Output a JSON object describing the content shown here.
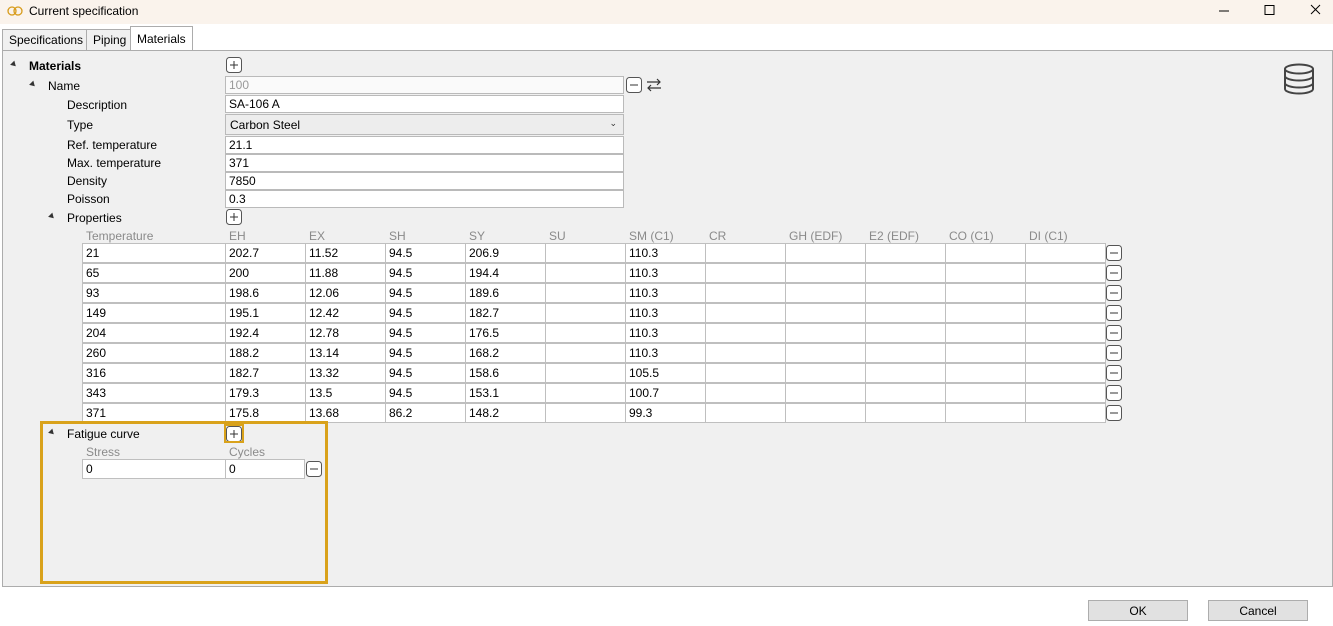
{
  "window": {
    "title": "Current specification",
    "title_icon": "link-icon",
    "controls": [
      "minimize-icon",
      "maximize-icon",
      "close-icon"
    ]
  },
  "tabs": [
    {
      "label": "Specifications",
      "active": false
    },
    {
      "label": "Piping",
      "active": false
    },
    {
      "label": "Materials",
      "active": true
    }
  ],
  "tree": {
    "materials_label": "Materials",
    "name_label": "Name",
    "name_value": "100",
    "fields": [
      {
        "label": "Description",
        "value": "SA-106 A"
      },
      {
        "label": "Type",
        "value": "Carbon Steel"
      },
      {
        "label": "Ref. temperature",
        "value": "21.1"
      },
      {
        "label": "Max. temperature",
        "value": "371"
      },
      {
        "label": "Density",
        "value": "7850"
      },
      {
        "label": "Poisson",
        "value": "0.3"
      }
    ],
    "properties_label": "Properties",
    "fatigue_label": "Fatigue curve"
  },
  "properties": {
    "columns": [
      "Temperature",
      "EH",
      "EX",
      "SH",
      "SY",
      "SU",
      "SM (C1)",
      "CR",
      "GH (EDF)",
      "E2 (EDF)",
      "CO (C1)",
      "DI (C1)"
    ],
    "rows": [
      [
        "21",
        "202.7",
        "11.52",
        "94.5",
        "206.9",
        "",
        "110.3",
        "",
        "",
        "",
        "",
        ""
      ],
      [
        "65",
        "200",
        "11.88",
        "94.5",
        "194.4",
        "",
        "110.3",
        "",
        "",
        "",
        "",
        ""
      ],
      [
        "93",
        "198.6",
        "12.06",
        "94.5",
        "189.6",
        "",
        "110.3",
        "",
        "",
        "",
        "",
        ""
      ],
      [
        "149",
        "195.1",
        "12.42",
        "94.5",
        "182.7",
        "",
        "110.3",
        "",
        "",
        "",
        "",
        ""
      ],
      [
        "204",
        "192.4",
        "12.78",
        "94.5",
        "176.5",
        "",
        "110.3",
        "",
        "",
        "",
        "",
        ""
      ],
      [
        "260",
        "188.2",
        "13.14",
        "94.5",
        "168.2",
        "",
        "110.3",
        "",
        "",
        "",
        "",
        ""
      ],
      [
        "316",
        "182.7",
        "13.32",
        "94.5",
        "158.6",
        "",
        "105.5",
        "",
        "",
        "",
        "",
        ""
      ],
      [
        "343",
        "179.3",
        "13.5",
        "94.5",
        "153.1",
        "",
        "100.7",
        "",
        "",
        "",
        "",
        ""
      ],
      [
        "371",
        "175.8",
        "13.68",
        "86.2",
        "148.2",
        "",
        "99.3",
        "",
        "",
        "",
        "",
        ""
      ]
    ]
  },
  "fatigue": {
    "columns": [
      "Stress",
      "Cycles"
    ],
    "rows": [
      [
        "0",
        "0"
      ]
    ]
  },
  "buttons": {
    "ok": "OK",
    "cancel": "Cancel"
  },
  "colors": {
    "highlight": "#d9a21b",
    "panel": "#f0f0f0",
    "titlebar": "#faf3ec"
  }
}
